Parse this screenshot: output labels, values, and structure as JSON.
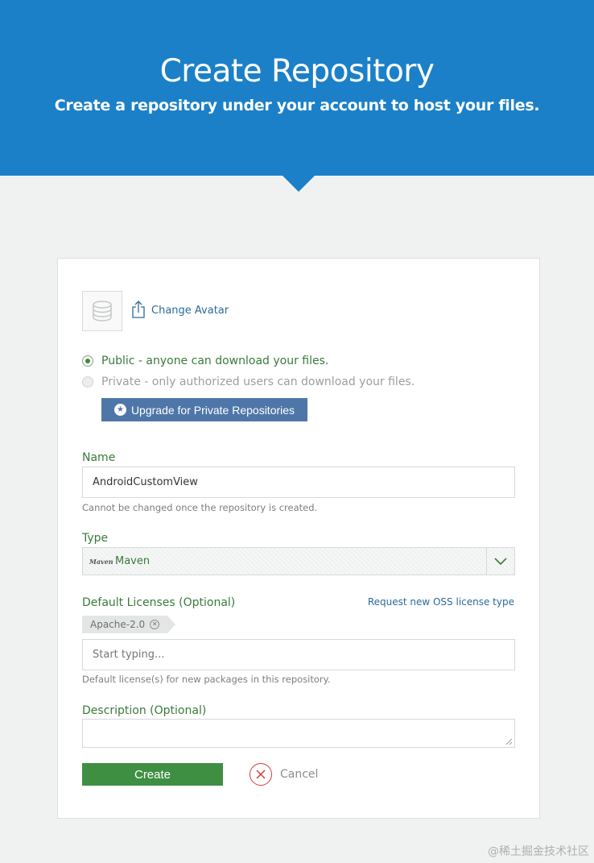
{
  "header": {
    "title": "Create Repository",
    "subtitle": "Create a repository under your account to host your files."
  },
  "avatar": {
    "change_label": "Change Avatar"
  },
  "visibility": {
    "public_label": "Public - anyone can download your files.",
    "private_label": "Private - only authorized users can download your files.",
    "selected": "public",
    "upgrade_label": "Upgrade for Private Repositories"
  },
  "name_field": {
    "label": "Name",
    "value": "AndroidCustomView",
    "help": "Cannot be changed once the repository is created."
  },
  "type_field": {
    "label": "Type",
    "logo_text": "Maven",
    "value": "Maven"
  },
  "licenses_field": {
    "label": "Default Licenses (Optional)",
    "request_link": "Request new OSS license type",
    "selected_tags": [
      "Apache-2.0"
    ],
    "placeholder": "Start typing...",
    "help": "Default license(s) for new packages in this repository."
  },
  "description_field": {
    "label": "Description (Optional)",
    "value": ""
  },
  "actions": {
    "create_label": "Create",
    "cancel_label": "Cancel"
  },
  "watermark": "@稀土掘金技术社区",
  "colors": {
    "header_bg": "#1b80c8",
    "create_button": "#3f8f43",
    "upgrade_button": "#4f76a8",
    "cancel_icon": "#d43c3c"
  }
}
